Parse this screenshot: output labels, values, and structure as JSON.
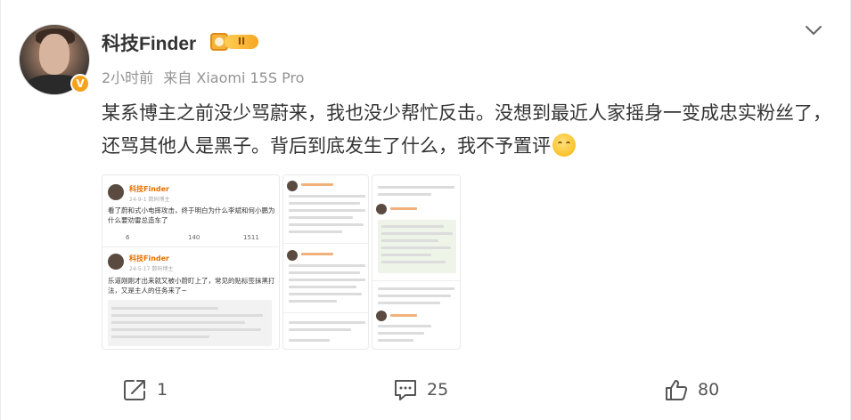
{
  "post": {
    "author": "科技Finder",
    "level_badge": "II",
    "time": "2小时前",
    "source": "来自 Xiaomi 15S Pro",
    "text": "某系博主之前没少骂蔚来，我也没少帮忙反击。没想到最近人家摇身一变成忠实粉丝了，还骂其他人是黑子。背后到底发生了什么，我不予置评",
    "emoji_icon": "cover-face-emoji"
  },
  "images": {
    "thumb1": {
      "post1": {
        "name": "科技Finder",
        "date": "24-9-1",
        "sub": "数码博主",
        "text": "看了蔚和式小电摔攻击，终于明白为什么李斌和何小鹏为什么要劝雷总造车了",
        "shares": "6",
        "comments": "140",
        "likes": "1511"
      },
      "post2": {
        "name": "科技Finder",
        "date": "24-5-17",
        "sub": "数码博主",
        "text": "乐道刚刚才出来就又被小蔚盯上了，常见的贴标签抹黑打法，又是主人的任务来了~"
      }
    }
  },
  "actions": {
    "share_count": "1",
    "comment_count": "25",
    "like_count": "80"
  },
  "colors": {
    "accent_orange": "#f7a21b",
    "meta_gray": "#939393"
  }
}
